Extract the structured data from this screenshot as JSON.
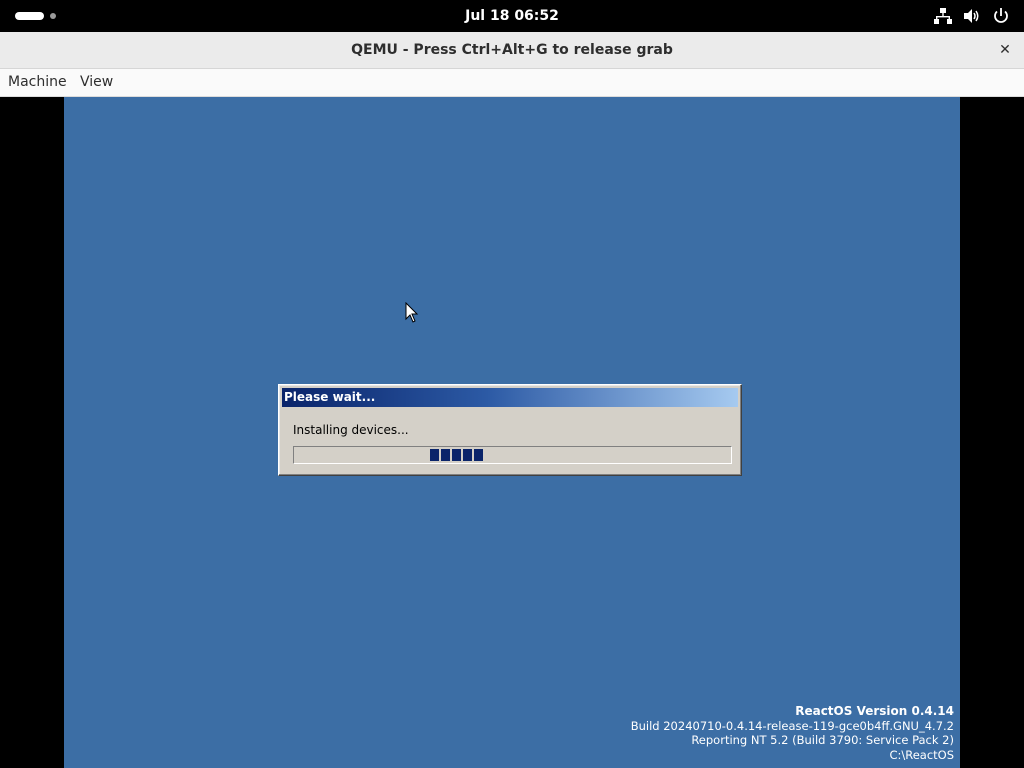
{
  "topbar": {
    "clock": "Jul 18  06:52",
    "icons": [
      "network-icon",
      "volume-icon",
      "power-icon"
    ]
  },
  "window": {
    "title": "QEMU - Press Ctrl+Alt+G to release grab",
    "close_label": "✕"
  },
  "menubar": {
    "items": [
      {
        "label": "Machine"
      },
      {
        "label": "View"
      }
    ]
  },
  "guest": {
    "background_color": "#3c6ea5",
    "dialog": {
      "title": "Please wait...",
      "message": "Installing devices...",
      "progress_blocks": 5
    },
    "version_info": {
      "title": "ReactOS Version 0.4.14",
      "build": "Build 20240710-0.4.14-release-119-gce0b4ff.GNU_4.7.2",
      "reporting": "Reporting NT 5.2 (Build 3790: Service Pack 2)",
      "path": "C:\\ReactOS"
    }
  }
}
